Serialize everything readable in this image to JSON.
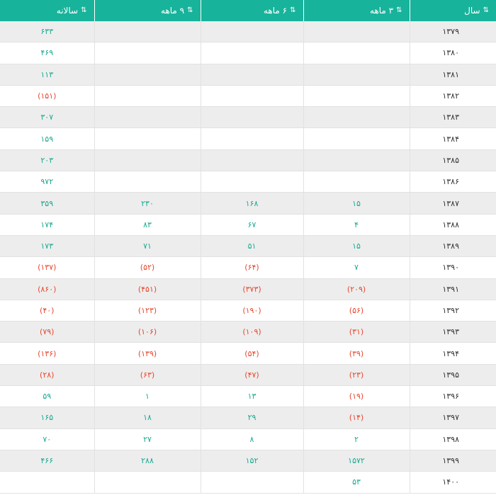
{
  "colors": {
    "header_bg": "#18b39b",
    "positive": "#1aa991",
    "negative": "#e8472e",
    "row_alt": "#ededed"
  },
  "header": {
    "year": "سال",
    "q3": "۳ ماهه",
    "q6": "۶ ماهه",
    "q9": "۹ ماهه",
    "annual": "سالانه",
    "sort_icon_year": "sort-numeric-icon",
    "sort_icon_cols": "sort-arrows-icon"
  },
  "rows": [
    {
      "year": "۱۳۷۹",
      "q3": "",
      "q6": "",
      "q9": "",
      "annual": "۶۳۳"
    },
    {
      "year": "۱۳۸۰",
      "q3": "",
      "q6": "",
      "q9": "",
      "annual": "۴۶۹"
    },
    {
      "year": "۱۳۸۱",
      "q3": "",
      "q6": "",
      "q9": "",
      "annual": "۱۱۳"
    },
    {
      "year": "۱۳۸۲",
      "q3": "",
      "q6": "",
      "q9": "",
      "annual": "(۱۵۱)"
    },
    {
      "year": "۱۳۸۳",
      "q3": "",
      "q6": "",
      "q9": "",
      "annual": "۳۰۷"
    },
    {
      "year": "۱۳۸۴",
      "q3": "",
      "q6": "",
      "q9": "",
      "annual": "۱۵۹"
    },
    {
      "year": "۱۳۸۵",
      "q3": "",
      "q6": "",
      "q9": "",
      "annual": "۲۰۳"
    },
    {
      "year": "۱۳۸۶",
      "q3": "",
      "q6": "",
      "q9": "",
      "annual": "۹۷۲"
    },
    {
      "year": "۱۳۸۷",
      "q3": "۱۵",
      "q6": "۱۶۸",
      "q9": "۲۳۰",
      "annual": "۳۵۹"
    },
    {
      "year": "۱۳۸۸",
      "q3": "۴",
      "q6": "۶۷",
      "q9": "۸۳",
      "annual": "۱۷۴"
    },
    {
      "year": "۱۳۸۹",
      "q3": "۱۵",
      "q6": "۵۱",
      "q9": "۷۱",
      "annual": "۱۷۳"
    },
    {
      "year": "۱۳۹۰",
      "q3": "۷",
      "q6": "(۶۴)",
      "q9": "(۵۲)",
      "annual": "(۱۳۷)"
    },
    {
      "year": "۱۳۹۱",
      "q3": "(۲۰۹)",
      "q6": "(۳۷۳)",
      "q9": "(۴۵۱)",
      "annual": "(۸۶۰)"
    },
    {
      "year": "۱۳۹۲",
      "q3": "(۵۶)",
      "q6": "(۱۹۰)",
      "q9": "(۱۲۳)",
      "annual": "(۴۰)"
    },
    {
      "year": "۱۳۹۳",
      "q3": "(۳۱)",
      "q6": "(۱۰۹)",
      "q9": "(۱۰۶)",
      "annual": "(۷۹)"
    },
    {
      "year": "۱۳۹۴",
      "q3": "(۳۹)",
      "q6": "(۵۴)",
      "q9": "(۱۳۹)",
      "annual": "(۱۳۶)"
    },
    {
      "year": "۱۳۹۵",
      "q3": "(۲۳)",
      "q6": "(۴۷)",
      "q9": "(۶۳)",
      "annual": "(۲۸)"
    },
    {
      "year": "۱۳۹۶",
      "q3": "(۱۹)",
      "q6": "۱۳",
      "q9": "۱",
      "annual": "۵۹"
    },
    {
      "year": "۱۳۹۷",
      "q3": "(۱۴)",
      "q6": "۲۹",
      "q9": "۱۸",
      "annual": "۱۶۵"
    },
    {
      "year": "۱۳۹۸",
      "q3": "۲",
      "q6": "۸",
      "q9": "۲۷",
      "annual": "۷۰"
    },
    {
      "year": "۱۳۹۹",
      "q3": "۱۵۷۲",
      "q6": "۱۵۲",
      "q9": "۲۸۸",
      "annual": "۴۶۶"
    },
    {
      "year": "۱۴۰۰",
      "q3": "۵۳",
      "q6": "",
      "q9": "",
      "annual": ""
    }
  ]
}
